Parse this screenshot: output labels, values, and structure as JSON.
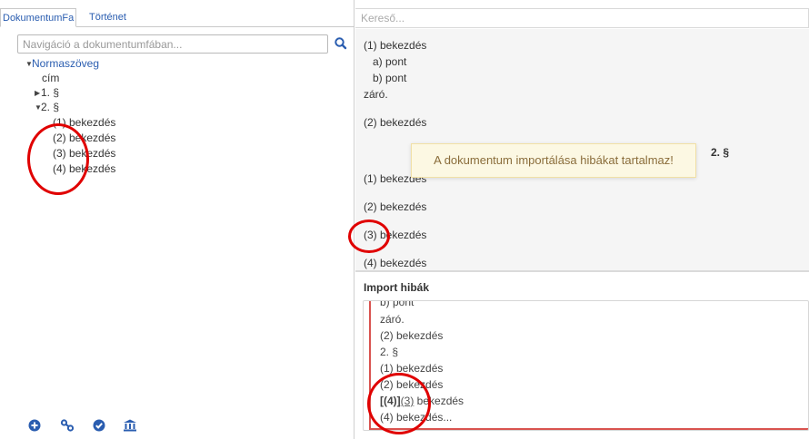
{
  "tabs": [
    {
      "label": "DokumentumFa"
    },
    {
      "label": "Történet"
    }
  ],
  "nav_search": {
    "placeholder": "Navigáció a dokumentumfában...",
    "button_icon": "search-icon"
  },
  "tree": {
    "root": "Normaszöveg",
    "items": [
      {
        "label": "cím"
      },
      {
        "label": "1. §"
      },
      {
        "label": "2. §"
      },
      {
        "label": "(1) bekezdés"
      },
      {
        "label": "(2) bekezdés"
      },
      {
        "label": "(3) bekezdés"
      },
      {
        "label": "(4) bekezdés"
      }
    ]
  },
  "bottom_toolbar": [
    {
      "icon": "plus-circle-icon"
    },
    {
      "icon": "link-icon"
    },
    {
      "icon": "check-circle-icon"
    },
    {
      "icon": "bank-icon"
    }
  ],
  "doc_search": {
    "placeholder": "Kereső..."
  },
  "document": {
    "lines": [
      "(1) bekezdés",
      "a) pont",
      "b) pont",
      "záró.",
      "(2) bekezdés",
      "2. §",
      "(1) bekezdés",
      "(2) bekezdés",
      "(3) bekezdés",
      "(4) bekezdés"
    ]
  },
  "toast": {
    "message": "A dokumentum importálása hibákat tartalmaz!"
  },
  "import_errors": {
    "title": "Import hibák",
    "lines": [
      "b) pont",
      "záró.",
      "(2) bekezdés",
      "2. §",
      "(1) bekezdés",
      "(2) bekezdés"
    ],
    "error_line": {
      "marker": "[(4)]",
      "link": "(3)",
      "rest": " bekezdés"
    },
    "last_line": "(4) bekezdés..."
  },
  "colors": {
    "accent": "#2a5db0",
    "error": "#d9534f",
    "annotation": "#e00000",
    "toast_bg": "#fcf8e3",
    "toast_text": "#8a6d3b"
  }
}
